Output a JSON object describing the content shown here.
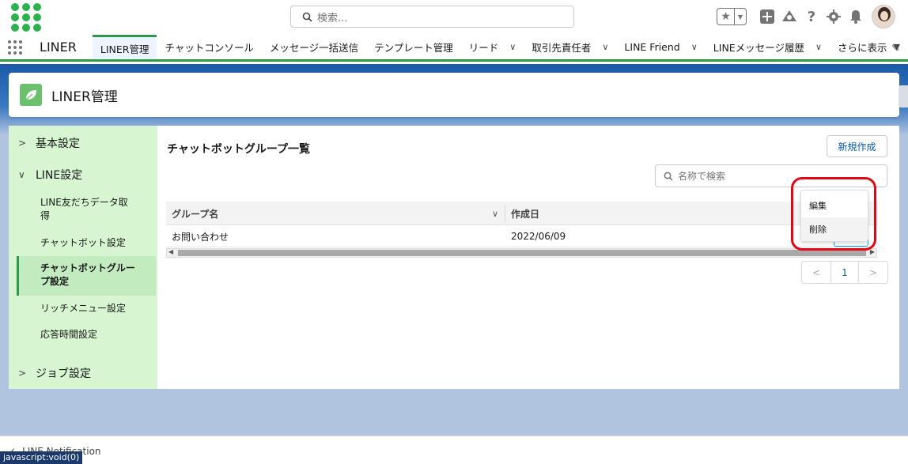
{
  "header": {
    "search_placeholder": "検索...",
    "icons": [
      "star-icon",
      "add-icon",
      "trailhead-icon",
      "help-icon",
      "setup-icon",
      "bell-icon",
      "avatar"
    ]
  },
  "nav": {
    "app_name": "LINER",
    "tabs": [
      {
        "label": "LINER管理",
        "active": true,
        "dropdown": false
      },
      {
        "label": "チャットコンソール",
        "active": false,
        "dropdown": false
      },
      {
        "label": "メッセージ一括送信",
        "active": false,
        "dropdown": false
      },
      {
        "label": "テンプレート管理",
        "active": false,
        "dropdown": false
      },
      {
        "label": "リード",
        "active": false,
        "dropdown": true
      },
      {
        "label": "取引先責任者",
        "active": false,
        "dropdown": true
      },
      {
        "label": "LINE Friend",
        "active": false,
        "dropdown": true
      },
      {
        "label": "LINEメッセージ履歴",
        "active": false,
        "dropdown": true
      },
      {
        "label": "さらに表示",
        "active": false,
        "dropdown": true
      }
    ]
  },
  "page_header": {
    "title": "LINER管理"
  },
  "sidebar": {
    "section1": "基本設定",
    "section2": "LINE設定",
    "items": [
      {
        "label": "LINE友だちデータ取得"
      },
      {
        "label": "チャットボット設定"
      },
      {
        "label": "チャットボットグループ設定"
      },
      {
        "label": "リッチメニュー設定"
      },
      {
        "label": "応答時間設定"
      }
    ],
    "section3": "ジョブ設定"
  },
  "main": {
    "title": "チャットボットグループ一覧",
    "new_button": "新規作成",
    "search_placeholder": "名称で検索",
    "columns": [
      "グループ名",
      "作成日"
    ],
    "rows": [
      {
        "name": "お問い合わせ",
        "created": "2022/06/09"
      }
    ],
    "pager": {
      "prev": "<",
      "page": "1",
      "next": ">"
    }
  },
  "row_menu": {
    "items": [
      "編集",
      "削除"
    ]
  },
  "footer": {
    "utility": "LINE Notification",
    "status_url": "javascript:void(0)"
  },
  "colors": {
    "accent_green": "#2e9a47",
    "sidebar_bg": "#d6f5d0",
    "highlight_red": "#e30613",
    "link_blue": "#0b5cab"
  }
}
